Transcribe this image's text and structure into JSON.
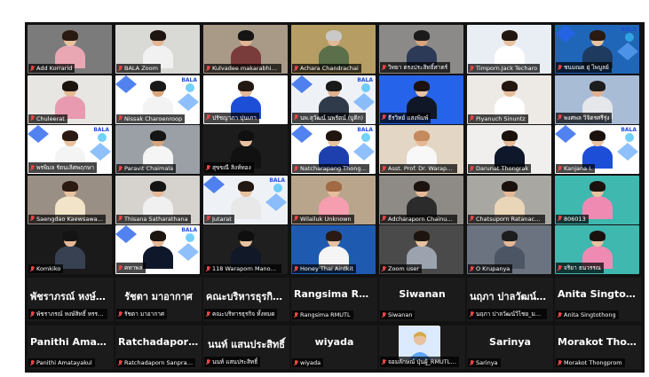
{
  "meeting": {
    "video_tiles": [
      {
        "id": "add-korrarid",
        "name": "Add Korrarid",
        "bg": "#7b7b7b",
        "skin": "#e8c2a0",
        "hair": "#2a1a12",
        "shirt": "#e9a7b4",
        "active": false,
        "logo": ""
      },
      {
        "id": "bala-zoom",
        "name": "BALA Zoom",
        "bg": "#d9d9d6",
        "skin": "#e2b593",
        "hair": "#1e1410",
        "shirt": "#f1f1f1",
        "active": true,
        "logo": ""
      },
      {
        "id": "kulvadee",
        "name": "Kulvadee makarabhirom",
        "bg": "#a89a86",
        "skin": "#e0b696",
        "hair": "#151515",
        "shirt": "#7a3b3b",
        "active": false,
        "logo": ""
      },
      {
        "id": "achara",
        "name": "Achara Chandrachai",
        "bg": "#b59d63",
        "skin": "#e3b896",
        "hair": "#c9c9c9",
        "shirt": "#5a6f4a",
        "active": false,
        "logo": ""
      },
      {
        "id": "tile-5",
        "name": "วิทยา ตรงประสิทธิ์ศาตร์",
        "bg": "#8c8a88",
        "skin": "#d7a57d",
        "hair": "#1b1b1b",
        "shirt": "#2d3a57",
        "active": false,
        "logo": ""
      },
      {
        "id": "timporn",
        "name": "Timporn.Jack Techaro",
        "bg": "#e9eef4",
        "skin": "#e8c2a0",
        "hair": "#231712",
        "shirt": "#ffffff",
        "active": false,
        "logo": ""
      },
      {
        "id": "tile-7",
        "name": "ชนมณต ยุ่ ไพบูลย์",
        "bg": "#1f66b8",
        "skin": "#e8c2a0",
        "hair": "#2a1a12",
        "shirt": "#1e3a5f",
        "active": false,
        "logo": "BALA"
      },
      {
        "id": "chuleerat",
        "name": "Chuleerat",
        "bg": "#e8e6e2",
        "skin": "#e5b896",
        "hair": "#1d140f",
        "shirt": "#e89bb0",
        "active": false,
        "logo": ""
      },
      {
        "id": "nissak",
        "name": "Nissak Charoenroop",
        "bg": "#ffffff",
        "skin": "#d9a67f",
        "hair": "#191919",
        "shirt": "#f3f3f3",
        "active": false,
        "logo": "BALA"
      },
      {
        "id": "tile-10",
        "name": "ปรัชญาภา ปุนเภา",
        "bg": "#ffffff",
        "skin": "#e3b896",
        "hair": "#241812",
        "shirt": "#1d4ed8",
        "active": false,
        "logo": ""
      },
      {
        "id": "tile-11",
        "name": "นพ.สุวัฒน์ นพรัตน์ (บูติก)",
        "bg": "#eef2f7",
        "skin": "#e0b090",
        "hair": "#191919",
        "shirt": "#2f3a4a",
        "active": false,
        "logo": "BALA"
      },
      {
        "id": "tile-12",
        "name": "ธีรวิทย์ แสงพิมพ์",
        "bg": "#2563eb",
        "skin": "#e8c2a0",
        "hair": "#1c120e",
        "shirt": "#101828",
        "active": false,
        "logo": ""
      },
      {
        "id": "piyanuch",
        "name": "Piyanuch Sinuntz",
        "bg": "#ede9e4",
        "skin": "#e6bd9c",
        "hair": "#22160f",
        "shirt": "#ffffff",
        "active": false,
        "logo": ""
      },
      {
        "id": "tile-14",
        "name": "พงศพล วิจิตรศรีรุ่ง",
        "bg": "#a9bcd6",
        "skin": "#e0b090",
        "hair": "#1d1d1d",
        "shirt": "#e5e7eb",
        "active": false,
        "logo": ""
      },
      {
        "id": "tile-15",
        "name": "พรพิมล รัตนเลิศพฤกษา",
        "bg": "#ffffff",
        "skin": "#e8c2a0",
        "hair": "#2a1a12",
        "shirt": "#f4f4f4",
        "active": false,
        "logo": "BALA"
      },
      {
        "id": "paravit",
        "name": "Paravit Chaimala",
        "bg": "#9aa0a6",
        "skin": "#d7a57d",
        "hair": "#141414",
        "shirt": "#f5f5f5",
        "active": false,
        "logo": ""
      },
      {
        "id": "tile-17",
        "name": "สุขขณี สิงห์ทอง",
        "bg": "#1c1c1c",
        "skin": "#e8c2a0",
        "hair": "#101010",
        "shirt": "#111111",
        "active": false,
        "logo": ""
      },
      {
        "id": "natchapang",
        "name": "Natcharapang Thongpin",
        "bg": "#ffffff",
        "skin": "#e8c2a0",
        "hair": "#1f140e",
        "shirt": "#1e40af",
        "active": false,
        "logo": "BALA"
      },
      {
        "id": "waraphon",
        "name": "Asst. Prof. Dr. Waraphon",
        "bg": "#e3d6c4",
        "skin": "#e5b896",
        "hair": "#c48a5e",
        "shirt": "#f8f8f8",
        "active": false,
        "logo": ""
      },
      {
        "id": "darunat",
        "name": "Darunat Thongrak",
        "bg": "#f0efee",
        "skin": "#e5b896",
        "hair": "#1a100c",
        "shirt": "#0f172a",
        "active": false,
        "logo": ""
      },
      {
        "id": "kanjana",
        "name": "Kanjana I.",
        "bg": "#ffffff",
        "skin": "#e8c2a0",
        "hair": "#1b120d",
        "shirt": "#1d4ed8",
        "active": false,
        "logo": "BALA"
      },
      {
        "id": "saengdao",
        "name": "Saengdao Kaewsawang",
        "bg": "#9a8f84",
        "skin": "#e8c2a0",
        "hair": "#2a1a12",
        "shirt": "#f1e4c9",
        "active": false,
        "logo": ""
      },
      {
        "id": "thisana",
        "name": "Thisana Satharathana",
        "bg": "#d6d3cf",
        "skin": "#e5b896",
        "hair": "#141414",
        "shirt": "#f0f0f0",
        "active": false,
        "logo": ""
      },
      {
        "id": "jutarat",
        "name": "Jutarat",
        "bg": "#eef2f7",
        "skin": "#e8c2a0",
        "hair": "#231712",
        "shirt": "#e8e8e8",
        "active": false,
        "logo": "BALA"
      },
      {
        "id": "wilailuk",
        "name": "Wilailuk Unknown",
        "bg": "#b9a58c",
        "skin": "#e6bd9c",
        "hair": "#a16a44",
        "shirt": "#f59eaf",
        "active": false,
        "logo": ""
      },
      {
        "id": "adcharaporn",
        "name": "Adcharaporn Chainuntan...",
        "bg": "#8e8a85",
        "skin": "#e5b896",
        "hair": "#1c130e",
        "shirt": "#2b2b2b",
        "active": false,
        "logo": ""
      },
      {
        "id": "chatsuporn",
        "name": "Chatsuporn Ratanachaiwa...",
        "bg": "#a9a7a2",
        "skin": "#e5b896",
        "hair": "#1a110c",
        "shirt": "#e9d5b7",
        "active": false,
        "logo": ""
      },
      {
        "id": "tile-28",
        "name": "806013",
        "bg": "#3fb8b0",
        "skin": "#e8c2a0",
        "hair": "#1b120d",
        "shirt": "#ef8bb3",
        "active": false,
        "logo": ""
      },
      {
        "id": "komkiko",
        "name": "Komkiko",
        "bg": "#1a1a1a",
        "skin": "#e5b896",
        "hair": "#141414",
        "shirt": "#374151",
        "active": false,
        "logo": ""
      },
      {
        "id": "tile-30",
        "name": "คทาพล",
        "bg": "#ffffff",
        "skin": "#e3b896",
        "hair": "#1e1410",
        "shirt": "#0f172a",
        "active": false,
        "logo": "BALA"
      },
      {
        "id": "tile-31",
        "name": "118 Waraporn Manowang",
        "bg": "#1f1f1f",
        "skin": "#e8c2a0",
        "hair": "#0f0f0f",
        "shirt": "#111827",
        "active": false,
        "logo": ""
      },
      {
        "id": "honey",
        "name": "Honey Thai Airdkit",
        "bg": "#1e5bb0",
        "skin": "#e8c2a0",
        "hair": "#2a1a12",
        "shirt": "#f5f5f5",
        "active": false,
        "logo": ""
      },
      {
        "id": "zoom-user",
        "name": "Zoom user",
        "bg": "#4a4a4a",
        "skin": "#e8c2a0",
        "hair": "#1d140f",
        "shirt": "#9ca3af",
        "active": false,
        "logo": ""
      },
      {
        "id": "o-kr",
        "name": "O Krupanya",
        "bg": "#6b7280",
        "skin": "#e5b896",
        "hair": "#1d1d1d",
        "shirt": "#4b5563",
        "active": false,
        "logo": ""
      },
      {
        "id": "tile-35",
        "name": "จริยา ธนวรรณ",
        "bg": "#3fb8b0",
        "skin": "#e8c2a0",
        "hair": "#1b120d",
        "shirt": "#ef8bb3",
        "active": false,
        "logo": ""
      }
    ],
    "audio_tiles_row1": [
      {
        "id": "a1",
        "big": "พัชราภรณ์ หงษ์สิ...",
        "small": "พัชราภรณ์ หงษ์สิทธิ์ หรรษาจิต..."
      },
      {
        "id": "a2",
        "big": "รัชตา มาอากาศ",
        "small": "รัชตา มาอากาศ"
      },
      {
        "id": "a3",
        "big": "คณะบริหารธุรกิจ...",
        "small": "คณะบริหารธุรกิจ ทั้งหมด"
      },
      {
        "id": "a4",
        "big": "Rangsima RMUTL",
        "small": "Rangsima RMUTL"
      },
      {
        "id": "a5",
        "big": "Siwanan",
        "small": "Siwanan"
      },
      {
        "id": "a6",
        "big": "นฤภา ปาลวัฒน์วิ...",
        "small": "นฤภา ปาลวัฒน์วิไชย_มทร.ล้า..."
      },
      {
        "id": "a7",
        "big": "Anita Singtotho...",
        "small": "Anita Singtothong"
      }
    ],
    "audio_tiles_row2": [
      {
        "id": "b1",
        "big": "Panithi Amatay...",
        "small": "Panithi Amatayakul",
        "photo": false
      },
      {
        "id": "b2",
        "big": "Ratchadaporn S...",
        "small": "Ratchadaporn Sanprasit",
        "photo": false
      },
      {
        "id": "b3",
        "big": "นนท์ แสนประสิทธิ์",
        "small": "นนท์ แสนประสิทธิ์",
        "photo": false
      },
      {
        "id": "b4",
        "big": "wiyada",
        "small": "wiyada",
        "photo": false
      },
      {
        "id": "b5",
        "big": "",
        "small": "จอมลักษณ์ ปุ่นผู้_RMUTL_CR",
        "photo": true
      },
      {
        "id": "b6",
        "big": "Sarinya",
        "small": "Sarinya",
        "photo": false
      },
      {
        "id": "b7",
        "big": "Morakot Thong...",
        "small": "Morakot Thongprom",
        "photo": false
      }
    ],
    "colors": {
      "gallery_bg": "#121212",
      "active_speaker": "#22c55e",
      "muted_mic": "#ef4444"
    },
    "icons": {
      "mic": "muted-mic-icon"
    }
  }
}
